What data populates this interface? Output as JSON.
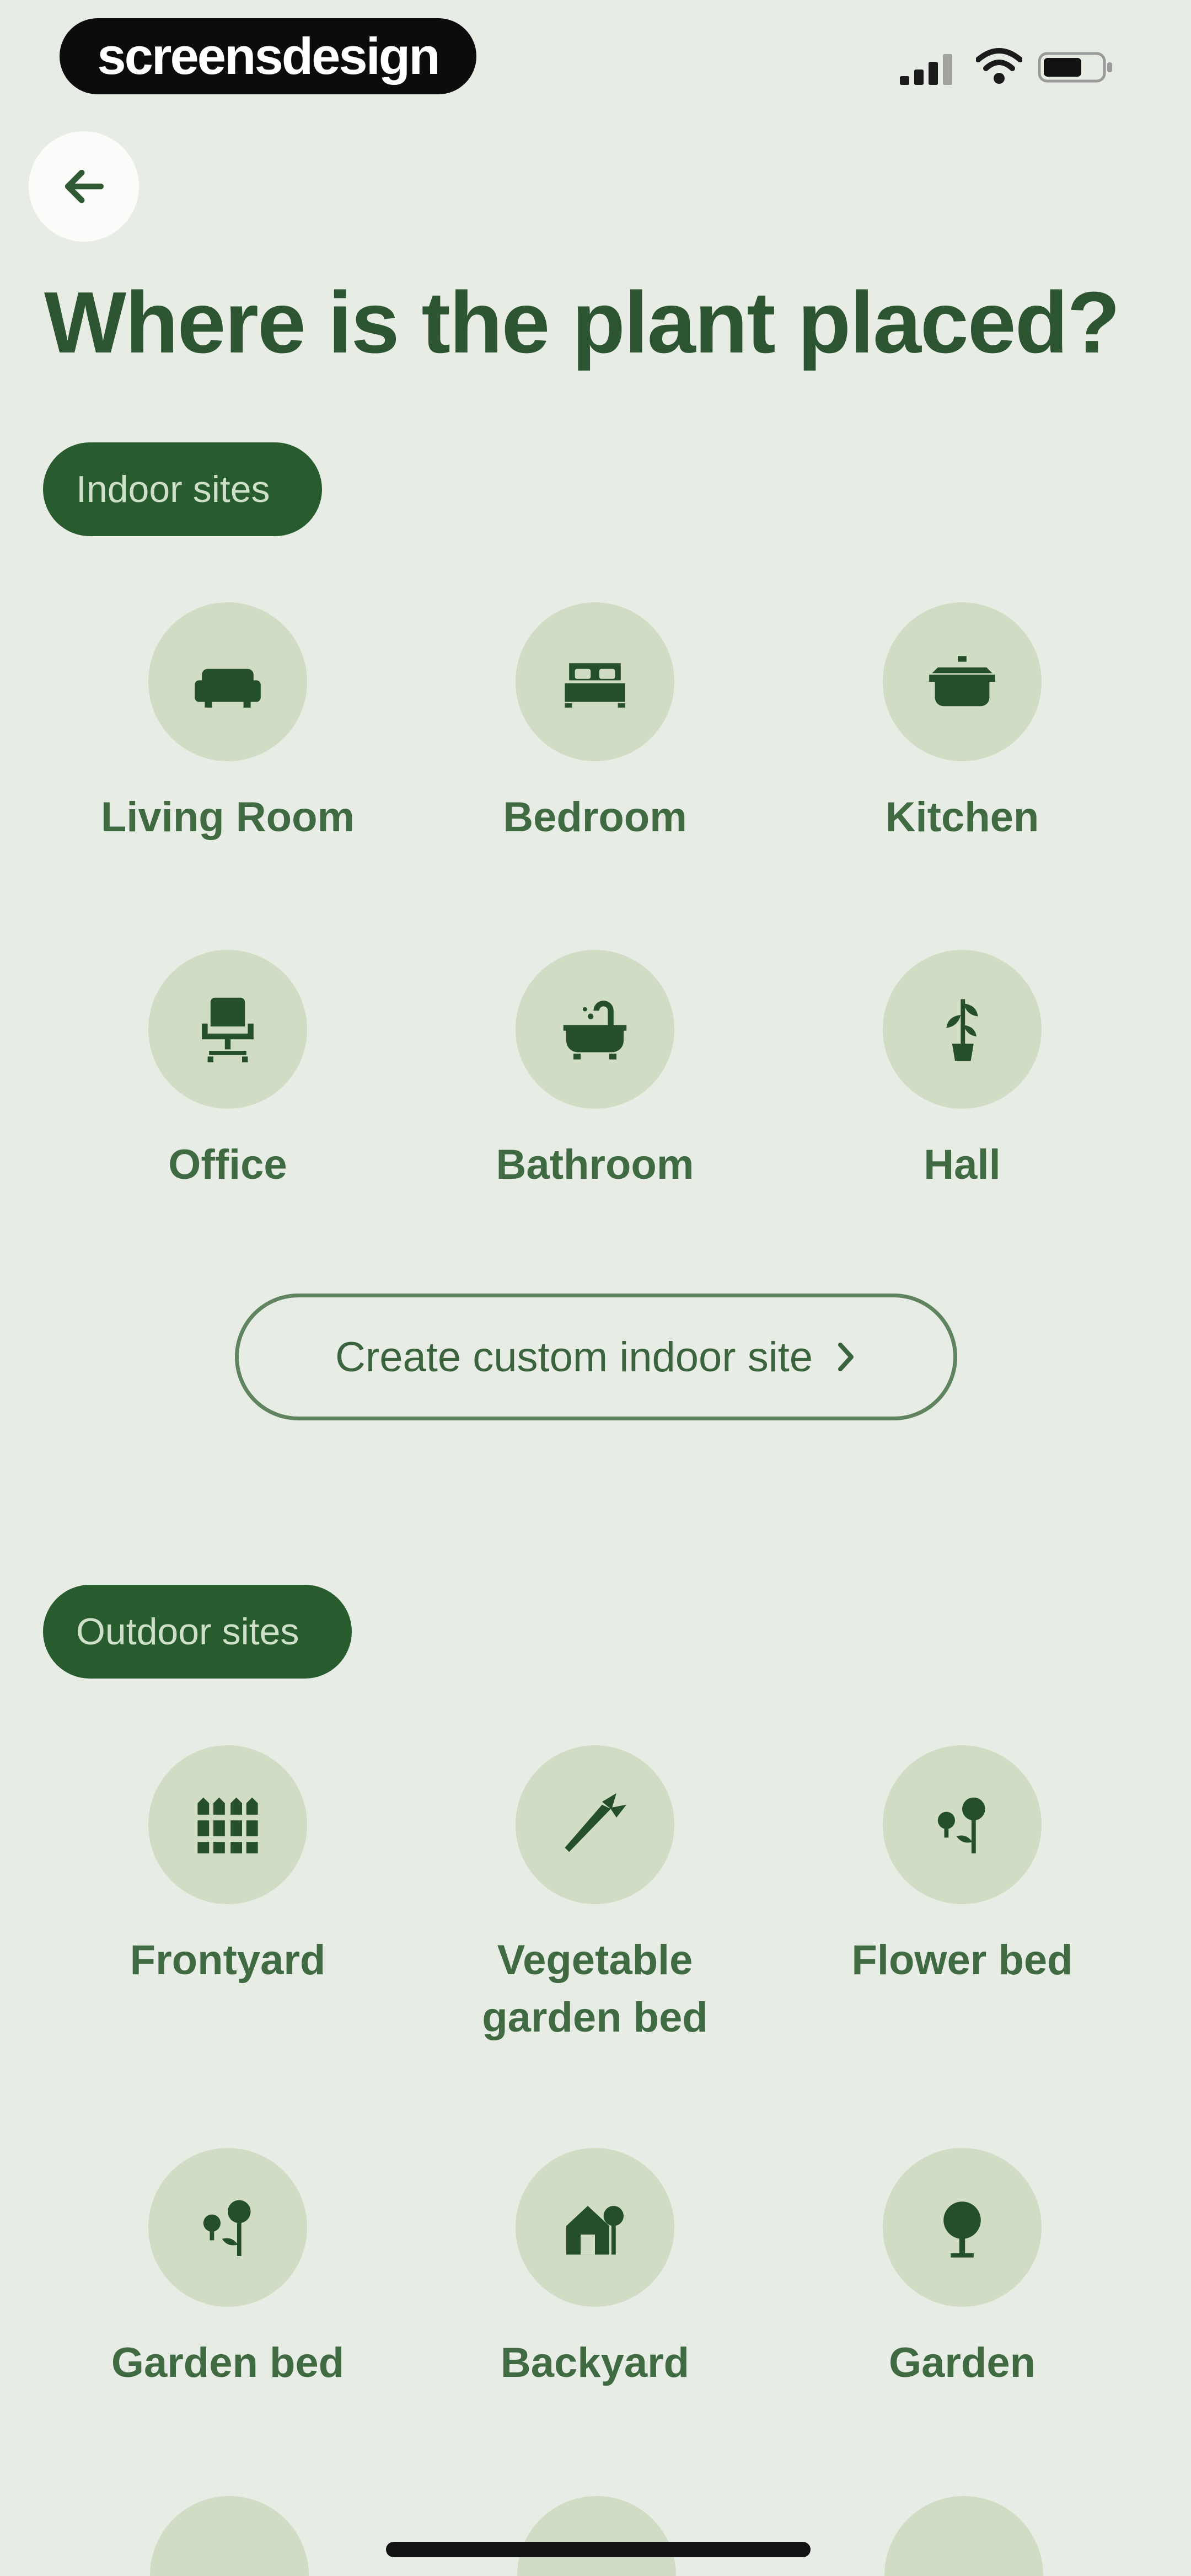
{
  "status_bar": {
    "brand": "screensdesign"
  },
  "header": {
    "title": "Where is the plant placed?"
  },
  "indoor": {
    "heading": "Indoor sites",
    "items": [
      {
        "label": "Living Room",
        "icon": "sofa-icon"
      },
      {
        "label": "Bedroom",
        "icon": "bed-icon"
      },
      {
        "label": "Kitchen",
        "icon": "cooking-pot-icon"
      },
      {
        "label": "Office",
        "icon": "office-chair-icon"
      },
      {
        "label": "Bathroom",
        "icon": "bathtub-icon"
      },
      {
        "label": "Hall",
        "icon": "hall-plant-icon"
      }
    ],
    "create_button": "Create custom indoor site"
  },
  "outdoor": {
    "heading": "Outdoor sites",
    "items": [
      {
        "label": "Frontyard",
        "icon": "fence-icon"
      },
      {
        "label": "Vegetable garden bed",
        "icon": "carrot-icon"
      },
      {
        "label": "Flower bed",
        "icon": "flowers-icon"
      },
      {
        "label": "Garden bed",
        "icon": "flowers-icon"
      },
      {
        "label": "Backyard",
        "icon": "house-tree-icon"
      },
      {
        "label": "Garden",
        "icon": "tree-icon"
      }
    ]
  },
  "colors": {
    "background": "#e7ece4",
    "accent": "#285c2e",
    "icon_circle": "#d0dcc4",
    "text": "#2f5a34"
  }
}
